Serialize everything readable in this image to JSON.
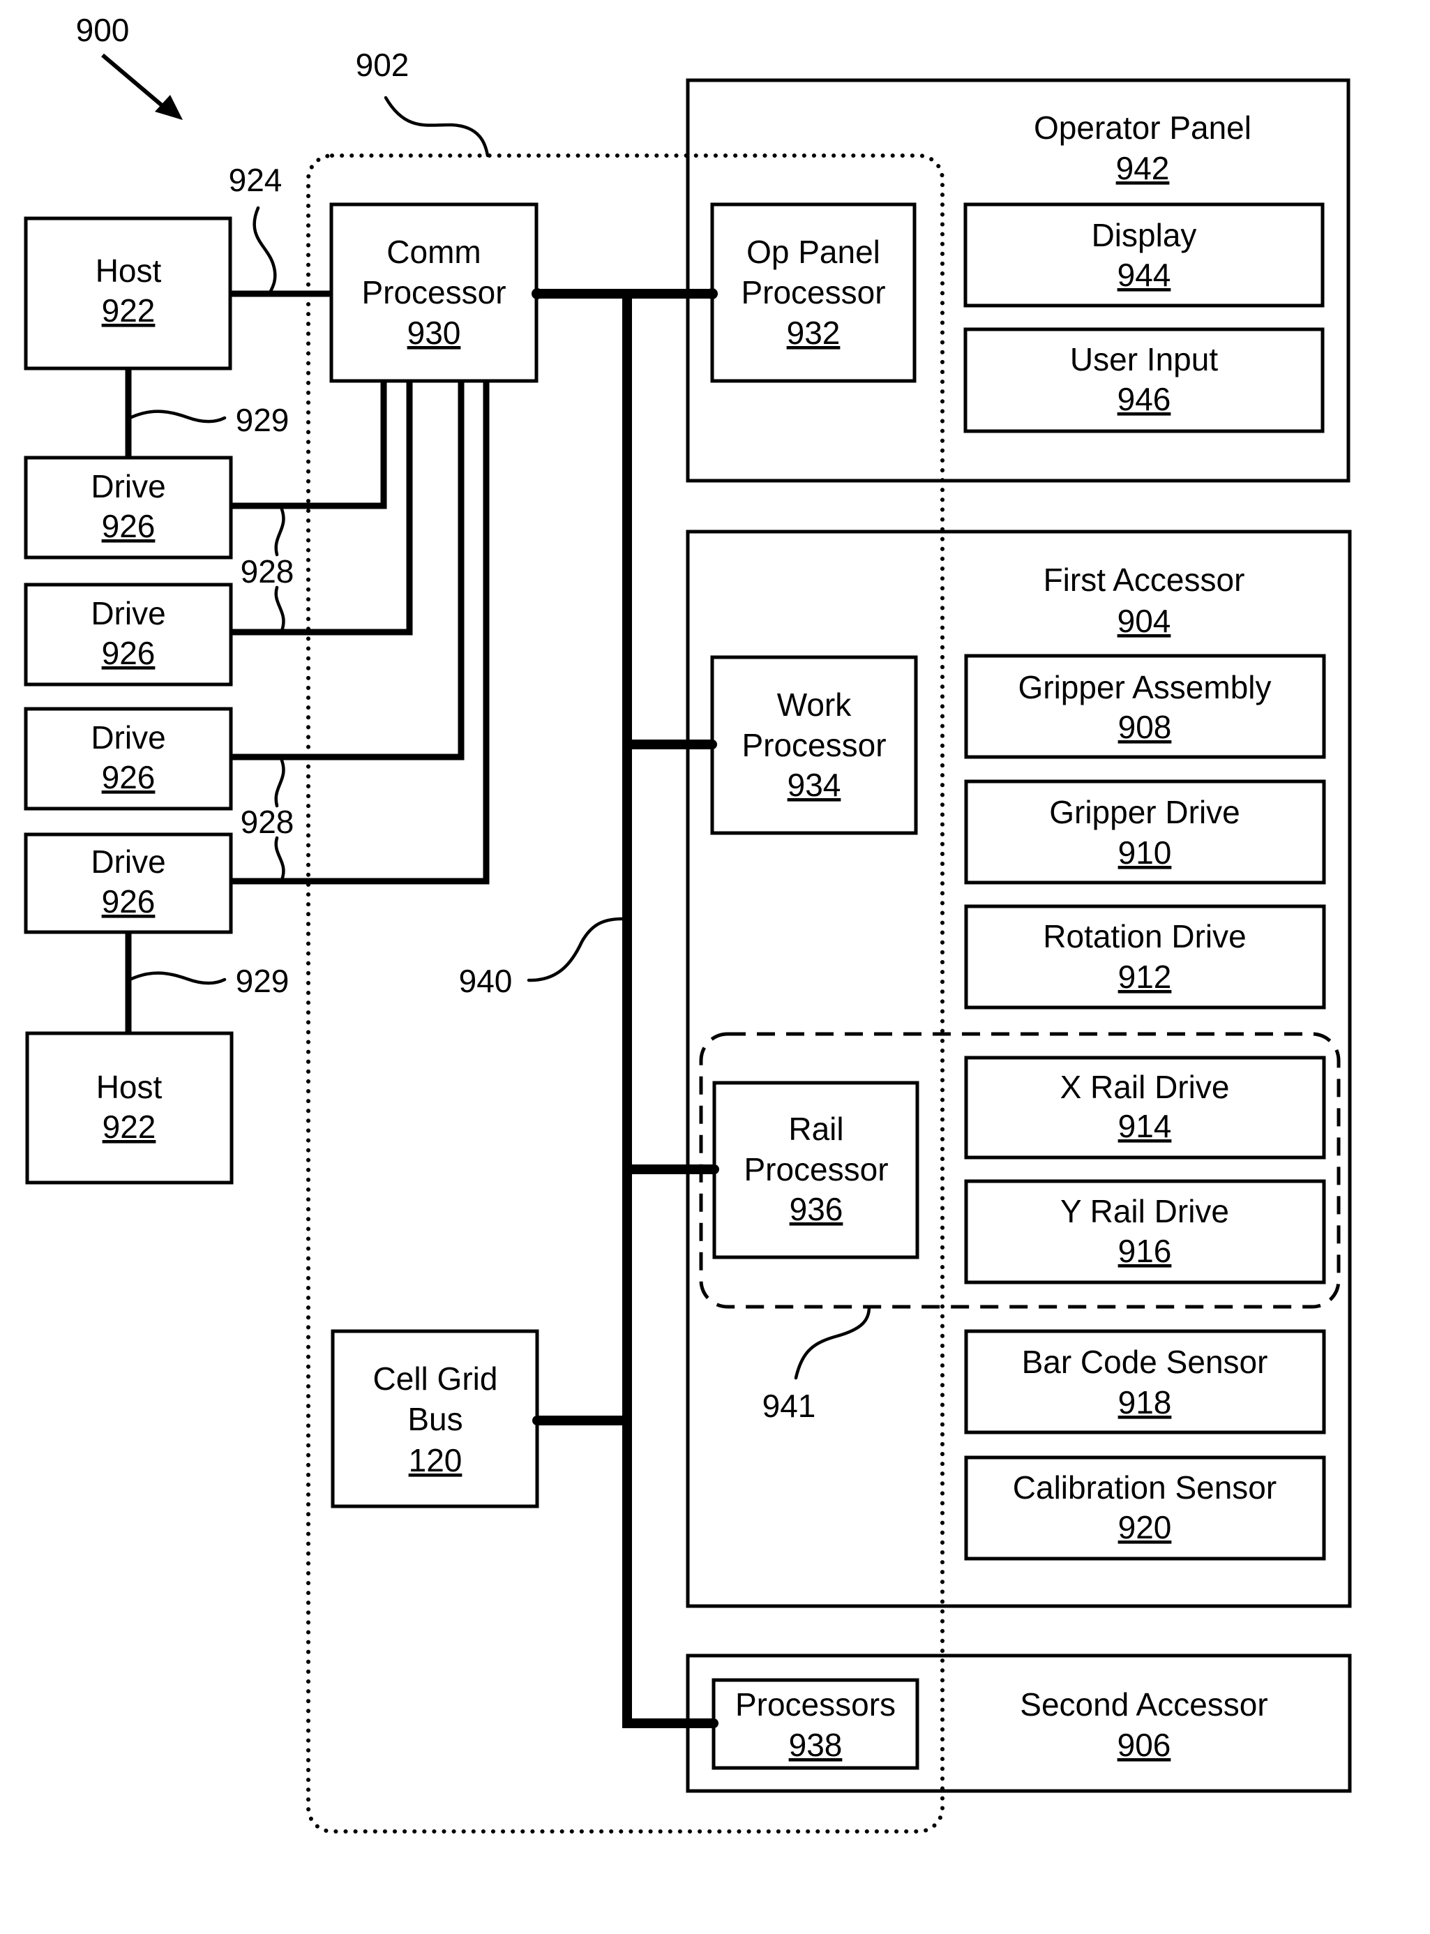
{
  "figure": {
    "figure_ref": "900",
    "callouts": {
      "controller_group": "902",
      "host_link": "924",
      "host_drive_link_top": "929",
      "host_drive_link_bottom": "929",
      "drive_link_upper": "928",
      "drive_link_lower": "928",
      "bus": "940",
      "rail_group": "941"
    },
    "hosts": [
      {
        "label": "Host",
        "ref": "922"
      },
      {
        "label": "Host",
        "ref": "922"
      }
    ],
    "drives": [
      {
        "label": "Drive",
        "ref": "926"
      },
      {
        "label": "Drive",
        "ref": "926"
      },
      {
        "label": "Drive",
        "ref": "926"
      },
      {
        "label": "Drive",
        "ref": "926"
      }
    ],
    "comm_processor": {
      "lines": [
        "Comm",
        "Processor"
      ],
      "ref": "930"
    },
    "cell_grid_bus": {
      "lines": [
        "Cell Grid",
        "Bus"
      ],
      "ref": "120"
    },
    "operator_panel": {
      "title": "Operator Panel",
      "ref": "942",
      "processor": {
        "lines": [
          "Op Panel",
          "Processor"
        ],
        "ref": "932"
      },
      "components": [
        {
          "label": "Display",
          "ref": "944"
        },
        {
          "label": "User Input",
          "ref": "946"
        }
      ]
    },
    "first_accessor": {
      "title": "First Accessor",
      "ref": "904",
      "work_processor": {
        "lines": [
          "Work",
          "Processor"
        ],
        "ref": "934"
      },
      "rail_processor": {
        "lines": [
          "Rail",
          "Processor"
        ],
        "ref": "936"
      },
      "components": [
        {
          "label": "Gripper Assembly",
          "ref": "908"
        },
        {
          "label": "Gripper Drive",
          "ref": "910"
        },
        {
          "label": "Rotation Drive",
          "ref": "912"
        },
        {
          "label": "X Rail Drive",
          "ref": "914"
        },
        {
          "label": "Y Rail Drive",
          "ref": "916"
        },
        {
          "label": "Bar Code Sensor",
          "ref": "918"
        },
        {
          "label": "Calibration Sensor",
          "ref": "920"
        }
      ]
    },
    "second_accessor": {
      "title": "Second Accessor",
      "ref": "906",
      "processors": {
        "label": "Processors",
        "ref": "938"
      }
    }
  }
}
